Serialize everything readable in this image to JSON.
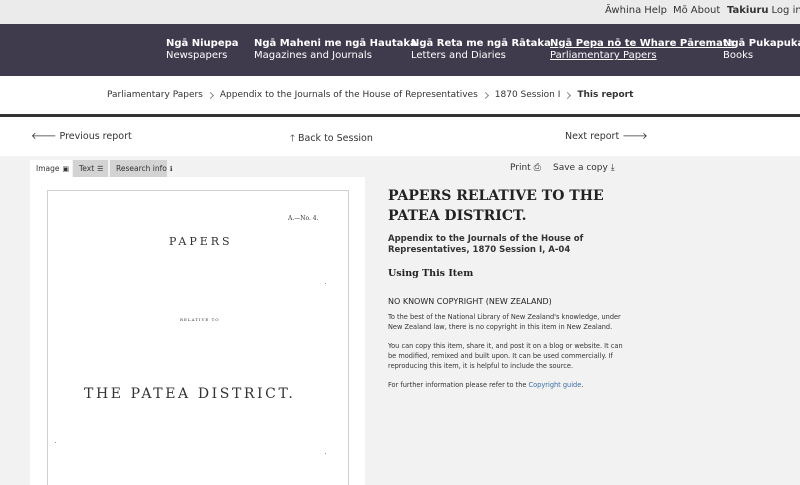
{
  "util": {
    "help_mi": "Āwhina",
    "help_en": "Help",
    "about_mi": "Mō",
    "about_en": "About",
    "login_mi": "Takiuru",
    "login_en": "Log in"
  },
  "nav": [
    {
      "mi": "Ngā Niupepa",
      "en": "Newspapers"
    },
    {
      "mi": "Ngā Maheni me ngā Hautaka",
      "en": "Magazines and Journals"
    },
    {
      "mi": "Ngā Reta me ngā Rātaka",
      "en": "Letters and Diaries"
    },
    {
      "mi": "Ngā Pepa nō te Whare Pāremata",
      "en": "Parliamentary Papers"
    },
    {
      "mi": "Ngā Pukapuka",
      "en": "Books"
    }
  ],
  "breadcrumb": [
    "Parliamentary Papers",
    "Appendix to the Journals of the House of Representatives",
    "1870 Session I",
    "This report"
  ],
  "report_nav": {
    "prev": "Previous report",
    "back": "Back to Session",
    "next": "Next report"
  },
  "viewer": {
    "tabs": [
      "Image",
      "Text",
      "Research info"
    ],
    "print": "Print",
    "save": "Save a copy",
    "scan": {
      "number": "A.—No. 4.",
      "papers": "PAPERS",
      "relative": "RELATIVE TO",
      "district": "THE PATEA DISTRICT."
    }
  },
  "info": {
    "title": "PAPERS RELATIVE TO THE PATEA DISTRICT.",
    "subtitle": "Appendix to the Journals of the House of Representatives, 1870 Session I, A-04",
    "using_heading": "Using This Item",
    "copyright_heading": "NO KNOWN COPYRIGHT (NEW ZEALAND)",
    "para1": "To the best of the National Library of New Zealand's knowledge, under New Zealand law, there is no copyright in this item in New Zealand.",
    "para2": "You can copy this item, share it, and post it on a blog or website. It can be modified, remixed and built upon. It can be used commercially. If reproducing this item, it is helpful to include the source.",
    "para3_prefix": "For further information please refer to the",
    "para3_link": "Copyright guide",
    "para3_suffix": "."
  }
}
